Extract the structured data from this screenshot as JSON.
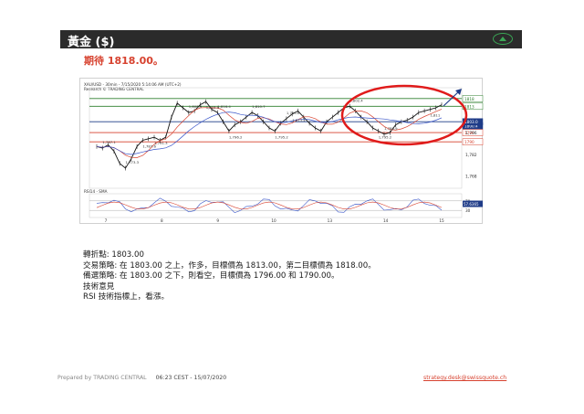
{
  "header": {
    "title": "黃金 ($)",
    "button_icon": "up-arrow-icon"
  },
  "expectation": "期待 1818.00。",
  "chart_data": {
    "type": "line",
    "title": "XAU/USD - 30min - 7/15/2020 5:14:06 AM (UTC+2)",
    "subtitle": "Research © TRADING CENTRAL",
    "x_tick_labels": [
      "7",
      "8",
      "9",
      "10",
      "13",
      "14",
      "15"
    ],
    "y_tick_labels": [
      "1,796",
      "1,782",
      "1,768"
    ],
    "price_tags": [
      {
        "label": "1818",
        "color": "#2d7f2d"
      },
      {
        "label": "1813",
        "color": "#2d7f2d"
      },
      {
        "label": "1800.4",
        "color": "#1f3c88"
      },
      {
        "label": "1803.0",
        "color": "#1f3c88"
      },
      {
        "label": "1796",
        "color": "#d7422f"
      },
      {
        "label": "1790",
        "color": "#d7422f"
      }
    ],
    "levels": [
      {
        "value": 1818,
        "color": "#2d7f2d"
      },
      {
        "value": 1813,
        "color": "#2d7f2d"
      },
      {
        "value": 1803,
        "color": "#1f3c88"
      },
      {
        "value": 1796,
        "color": "#d7422f"
      },
      {
        "value": 1790,
        "color": "#d7422f"
      }
    ],
    "price_annotations": [
      "1,787.1",
      "1,787.6",
      "1,773.3",
      "1,791.3",
      "1,808.9",
      "1,815.9",
      "1,816.4",
      "1,796.2",
      "1,810.7",
      "1,795.2",
      "1,795.2",
      "1,813.4",
      "1,802.4",
      "1,795.2",
      "1,789.9",
      "1,811"
    ],
    "rsi_label": "RSI14 - SMA",
    "rsi_ticks": [
      "70",
      "30"
    ],
    "rsi_value": "57.6365",
    "ylim": [
      1760,
      1825
    ]
  },
  "analysis": {
    "pivot": "轉折點: 1803.00",
    "strategy": "交易策略: 在 1803.00 之上，作多，目標價為 1813.00，第二目標價為 1818.00。",
    "alternative": "備選策略: 在 1803.00 之下，則看空，目標價為 1796.00 和 1790.00。",
    "comment_title": "技術意見",
    "comment": "RSI 技術指標上，看漲。"
  },
  "footer": {
    "prepared": "Prepared by TRADING CENTRAL",
    "timestamp": "06:23 CEST - 15/07/2020",
    "email": "strategy.desk@swissquote.ch"
  },
  "colors": {
    "header_bg": "#2b2b2b",
    "accent_red": "#d7422f",
    "green": "#2d7f2d",
    "blue": "#1f3c88"
  }
}
